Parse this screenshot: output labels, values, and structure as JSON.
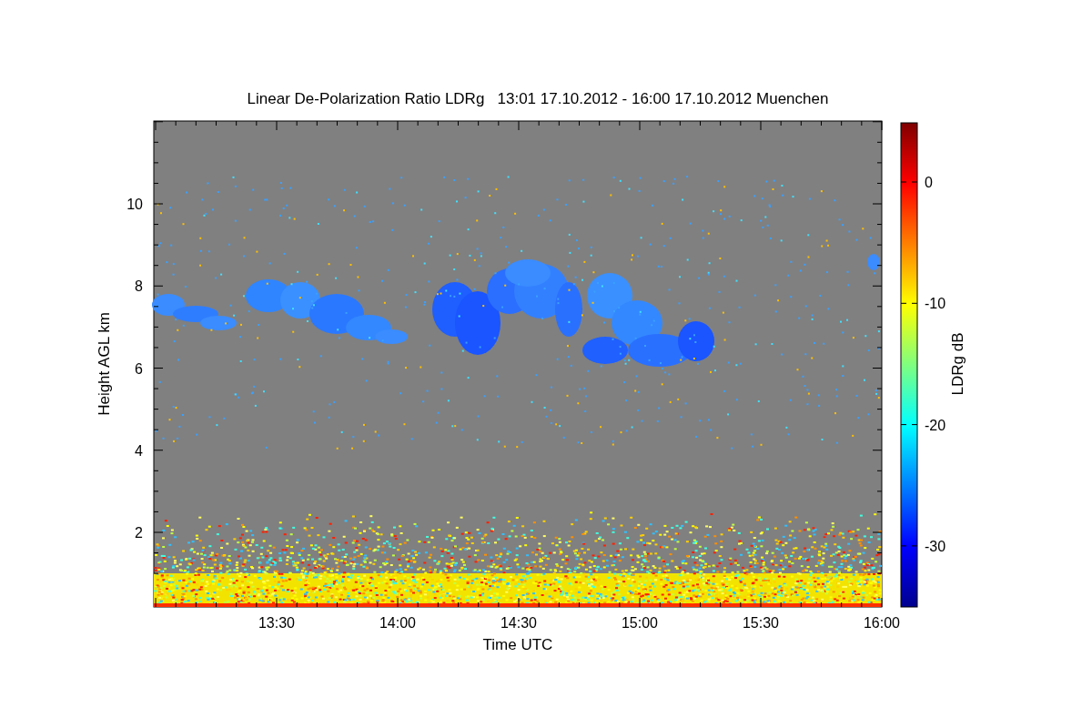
{
  "title": "Linear De-Polarization Ratio LDRg   13:01 17.10.2012 - 16:00 17.10.2012 Muenchen",
  "x_axis": {
    "label": "Time UTC",
    "ticks": [
      "13:30",
      "14:00",
      "14:30",
      "15:00",
      "15:30",
      "16:00"
    ]
  },
  "y_axis": {
    "label": "Height AGL km",
    "ticks": [
      "10",
      "8",
      "6",
      "4",
      "2"
    ]
  },
  "colorbar": {
    "label": "LDRg dB",
    "ticks": [
      "0",
      "-10",
      "-20",
      "-30"
    ]
  }
}
